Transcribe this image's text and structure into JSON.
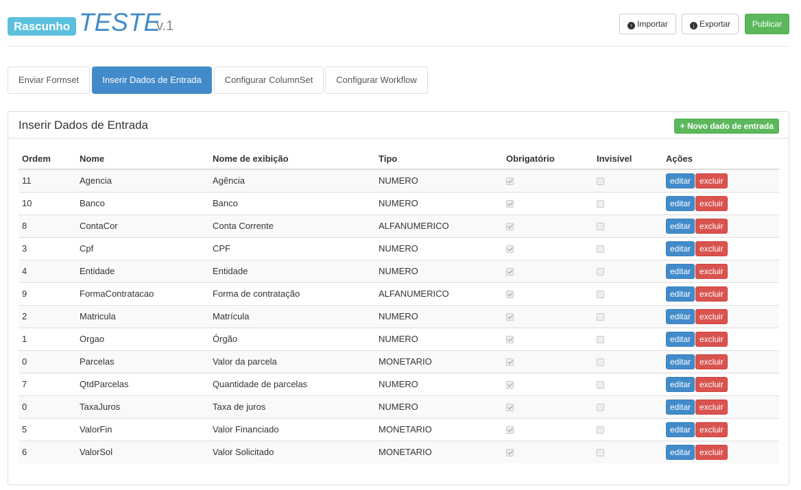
{
  "header": {
    "badge": "Rascunho",
    "title": "TESTE",
    "version": "v.1",
    "import_label": "Importar",
    "export_label": "Exportar",
    "publish_label": "Publicar"
  },
  "tabs": [
    {
      "label": "Enviar Formset",
      "active": false
    },
    {
      "label": "Inserir Dados de Entrada",
      "active": true
    },
    {
      "label": "Configurar ColumnSet",
      "active": false
    },
    {
      "label": "Configurar Workflow",
      "active": false
    }
  ],
  "panel": {
    "title": "Inserir Dados de Entrada",
    "new_button_label": "Novo dado de entrada"
  },
  "table": {
    "headers": [
      "Ordem",
      "Nome",
      "Nome de exibição",
      "Tipo",
      "Obrigatório",
      "Invisível",
      "Ações"
    ],
    "edit_label": "editar",
    "delete_label": "excluir",
    "rows": [
      {
        "ordem": "11",
        "nome": "Agencia",
        "exibicao": "Agência",
        "tipo": "NUMERO",
        "obrigatorio": true,
        "invisivel": false
      },
      {
        "ordem": "10",
        "nome": "Banco",
        "exibicao": "Banco",
        "tipo": "NUMERO",
        "obrigatorio": true,
        "invisivel": false
      },
      {
        "ordem": "8",
        "nome": "ContaCor",
        "exibicao": "Conta Corrente",
        "tipo": "ALFANUMERICO",
        "obrigatorio": true,
        "invisivel": false
      },
      {
        "ordem": "3",
        "nome": "Cpf",
        "exibicao": "CPF",
        "tipo": "NUMERO",
        "obrigatorio": true,
        "invisivel": false
      },
      {
        "ordem": "4",
        "nome": "Entidade",
        "exibicao": "Entidade",
        "tipo": "NUMERO",
        "obrigatorio": true,
        "invisivel": false
      },
      {
        "ordem": "9",
        "nome": "FormaContratacao",
        "exibicao": "Forma de contratação",
        "tipo": "ALFANUMERICO",
        "obrigatorio": true,
        "invisivel": false
      },
      {
        "ordem": "2",
        "nome": "Matricula",
        "exibicao": "Matrícula",
        "tipo": "NUMERO",
        "obrigatorio": true,
        "invisivel": false
      },
      {
        "ordem": "1",
        "nome": "Orgao",
        "exibicao": "Órgão",
        "tipo": "NUMERO",
        "obrigatorio": true,
        "invisivel": false
      },
      {
        "ordem": "0",
        "nome": "Parcelas",
        "exibicao": "Valor da parcela",
        "tipo": "MONETARIO",
        "obrigatorio": true,
        "invisivel": false
      },
      {
        "ordem": "7",
        "nome": "QtdParcelas",
        "exibicao": "Quantidade de parcelas",
        "tipo": "NUMERO",
        "obrigatorio": true,
        "invisivel": false
      },
      {
        "ordem": "0",
        "nome": "TaxaJuros",
        "exibicao": "Taxa de juros",
        "tipo": "NUMERO",
        "obrigatorio": true,
        "invisivel": false
      },
      {
        "ordem": "5",
        "nome": "ValorFin",
        "exibicao": "Valor Financiado",
        "tipo": "MONETARIO",
        "obrigatorio": true,
        "invisivel": false
      },
      {
        "ordem": "6",
        "nome": "ValorSol",
        "exibicao": "Valor Solicitado",
        "tipo": "MONETARIO",
        "obrigatorio": true,
        "invisivel": false
      }
    ]
  },
  "colors": {
    "primary": "#428bca",
    "success": "#5cb85c",
    "danger": "#d9534f",
    "info": "#5bc0de"
  }
}
